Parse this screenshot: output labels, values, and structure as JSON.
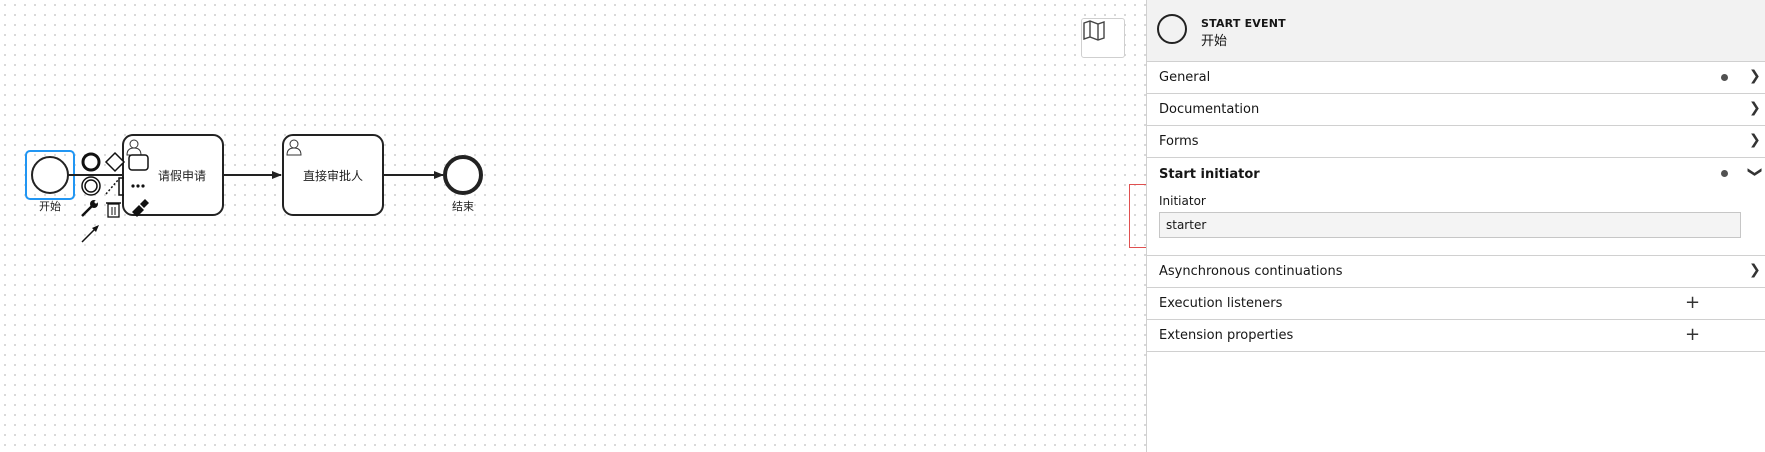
{
  "diagram": {
    "start_label": "开始",
    "task1_label": "请假申请",
    "task2_label": "直接审批人",
    "end_label": "结束"
  },
  "minimap": {
    "icon": "map-icon"
  },
  "panel": {
    "header": {
      "type": "START EVENT",
      "name": "开始",
      "icon": "start-event-circle-icon"
    },
    "groups": {
      "general": "General",
      "documentation": "Documentation",
      "forms": "Forms",
      "start_initiator": "Start initiator",
      "async": "Asynchronous continuations",
      "exec_listeners": "Execution listeners",
      "ext_props": "Extension properties"
    },
    "initiator": {
      "label": "Initiator",
      "value": "starter"
    }
  }
}
